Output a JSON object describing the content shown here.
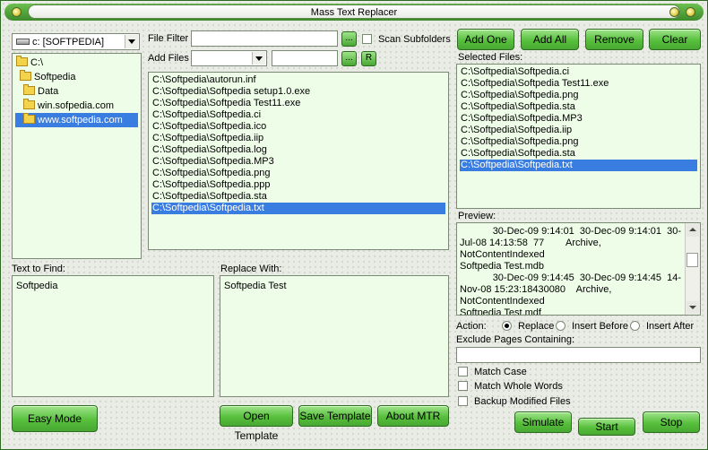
{
  "window": {
    "title": "Mass Text Replacer"
  },
  "drive": {
    "value": "c: [SOFTPEDIA]"
  },
  "folders": [
    {
      "label": "C:\\",
      "selected": false
    },
    {
      "label": "Softpedia",
      "selected": false
    },
    {
      "label": "Data",
      "selected": false
    },
    {
      "label": "win.sofpedia.com",
      "selected": false
    },
    {
      "label": "www.softpedia.com",
      "selected": true
    }
  ],
  "filter": {
    "file_filter_label": "File Filter",
    "file_filter_value": "",
    "browse_label": "...",
    "scan_subfolders_label": "Scan Subfolders",
    "add_files_label": "Add Files",
    "add_files_value": "",
    "add_files_text": "",
    "browse2_label": "...",
    "r_label": "R"
  },
  "files": [
    {
      "path": "C:\\Softpedia\\autorun.inf",
      "selected": false
    },
    {
      "path": "C:\\Softpedia\\Softpedia setup1.0.exe",
      "selected": false
    },
    {
      "path": "C:\\Softpedia\\Softpedia Test11.exe",
      "selected": false
    },
    {
      "path": "C:\\Softpedia\\Softpedia.ci",
      "selected": false
    },
    {
      "path": "C:\\Softpedia\\Softpedia.ico",
      "selected": false
    },
    {
      "path": "C:\\Softpedia\\Softpedia.iip",
      "selected": false
    },
    {
      "path": "C:\\Softpedia\\Softpedia.log",
      "selected": false
    },
    {
      "path": "C:\\Softpedia\\Softpedia.MP3",
      "selected": false
    },
    {
      "path": "C:\\Softpedia\\Softpedia.png",
      "selected": false
    },
    {
      "path": "C:\\Softpedia\\Softpedia.ppp",
      "selected": false
    },
    {
      "path": "C:\\Softpedia\\Softpedia.sta",
      "selected": false
    },
    {
      "path": "C:\\Softpedia\\Softpedia.txt",
      "selected": true
    }
  ],
  "buttons": {
    "add_one": "Add One",
    "add_all": "Add All",
    "remove": "Remove",
    "clear": "Clear",
    "easy_mode": "Easy Mode",
    "open_template": "Open Template",
    "save_template": "Save Template",
    "about": "About MTR",
    "simulate": "Simulate",
    "start": "Start",
    "stop": "Stop"
  },
  "selected_files": {
    "label": "Selected Files:",
    "items": [
      {
        "path": "C:\\Softpedia\\Softpedia.ci",
        "selected": false
      },
      {
        "path": "C:\\Softpedia\\Softpedia Test11.exe",
        "selected": false
      },
      {
        "path": "C:\\Softpedia\\Softpedia.png",
        "selected": false
      },
      {
        "path": "C:\\Softpedia\\Softpedia.sta",
        "selected": false
      },
      {
        "path": "C:\\Softpedia\\Softpedia.MP3",
        "selected": false
      },
      {
        "path": "C:\\Softpedia\\Softpedia.iip",
        "selected": false
      },
      {
        "path": "C:\\Softpedia\\Softpedia.png",
        "selected": false
      },
      {
        "path": "C:\\Softpedia\\Softpedia.sta",
        "selected": false
      },
      {
        "path": "C:\\Softpedia\\Softpedia.txt",
        "selected": true
      }
    ]
  },
  "preview": {
    "label": "Preview:",
    "text": "            30-Dec-09 9:14:01  30-Dec-09 9:14:01  30-Jul-08 14:13:58  77        Archive, NotContentIndexed\nSoftpedia Test.mdb\n            30-Dec-09 9:14:45  30-Dec-09 9:14:45  14-Nov-08 15:23:18430080    Archive, NotContentIndexed\nSoftpedia Test.mdf"
  },
  "find": {
    "label": "Text to Find:",
    "value": "Softpedia"
  },
  "replace": {
    "label": "Replace With:",
    "value": "Softpedia Test"
  },
  "action": {
    "label": "Action:",
    "replace": "Replace",
    "insert_before": "Insert Before",
    "insert_after": "Insert After",
    "selected": "replace"
  },
  "exclude": {
    "label": "Exclude Pages Containing:",
    "value": ""
  },
  "options": {
    "match_case": "Match Case",
    "match_whole_words": "Match Whole Words",
    "backup": "Backup Modified Files"
  },
  "colors": {
    "accent": "#57c03c",
    "selection": "#3a7de0",
    "panel_bg": "#eefde8"
  }
}
